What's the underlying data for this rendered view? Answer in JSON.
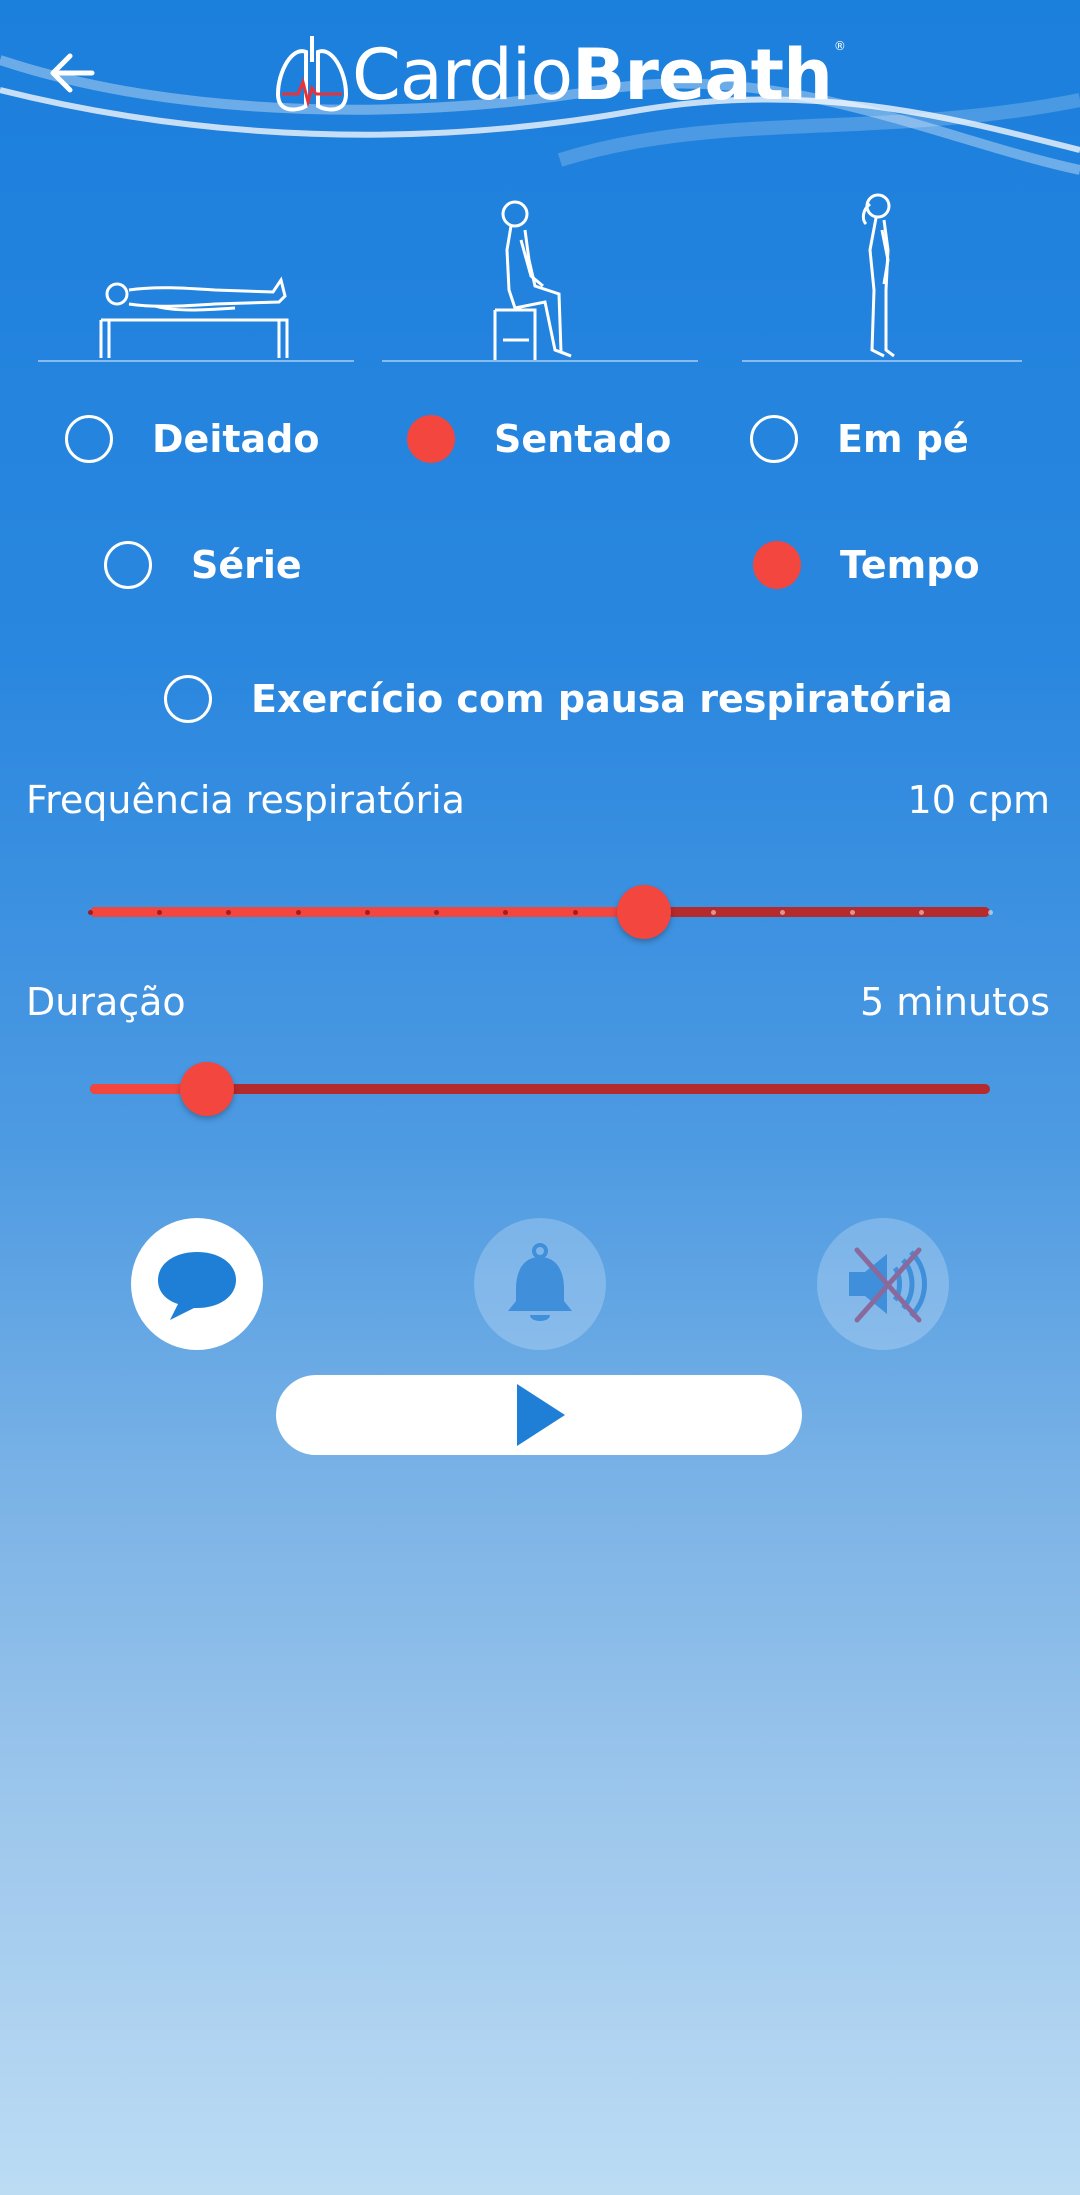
{
  "header": {
    "logo_regular": "Cardio",
    "logo_bold": "Breath",
    "logo_mark": "®",
    "back_icon": "arrow-left-icon"
  },
  "positions": {
    "items": [
      {
        "label": "Deitado",
        "selected": false
      },
      {
        "label": "Sentado",
        "selected": true
      },
      {
        "label": "Em pé",
        "selected": false
      }
    ]
  },
  "mode": {
    "items": [
      {
        "label": "Série",
        "selected": false
      },
      {
        "label": "Tempo",
        "selected": true
      }
    ]
  },
  "pause_option": {
    "label": "Exercício com pausa respiratória",
    "selected": false
  },
  "frequency": {
    "label": "Frequência respiratória",
    "value_text": "10 cpm",
    "level": 0.615
  },
  "duration": {
    "label": "Duração",
    "value_text": "5 minutos",
    "level": 0.13
  },
  "sound_buttons": [
    {
      "name": "speech",
      "icon": "speech-bubble-icon",
      "active": true
    },
    {
      "name": "bell",
      "icon": "bell-icon",
      "active": false
    },
    {
      "name": "mute",
      "icon": "speaker-muted-icon",
      "active": false
    }
  ],
  "play_icon": "play-icon",
  "colors": {
    "accent": "#f2463e",
    "primary": "#1b7fdc",
    "track_dark": "#b52a2c"
  }
}
